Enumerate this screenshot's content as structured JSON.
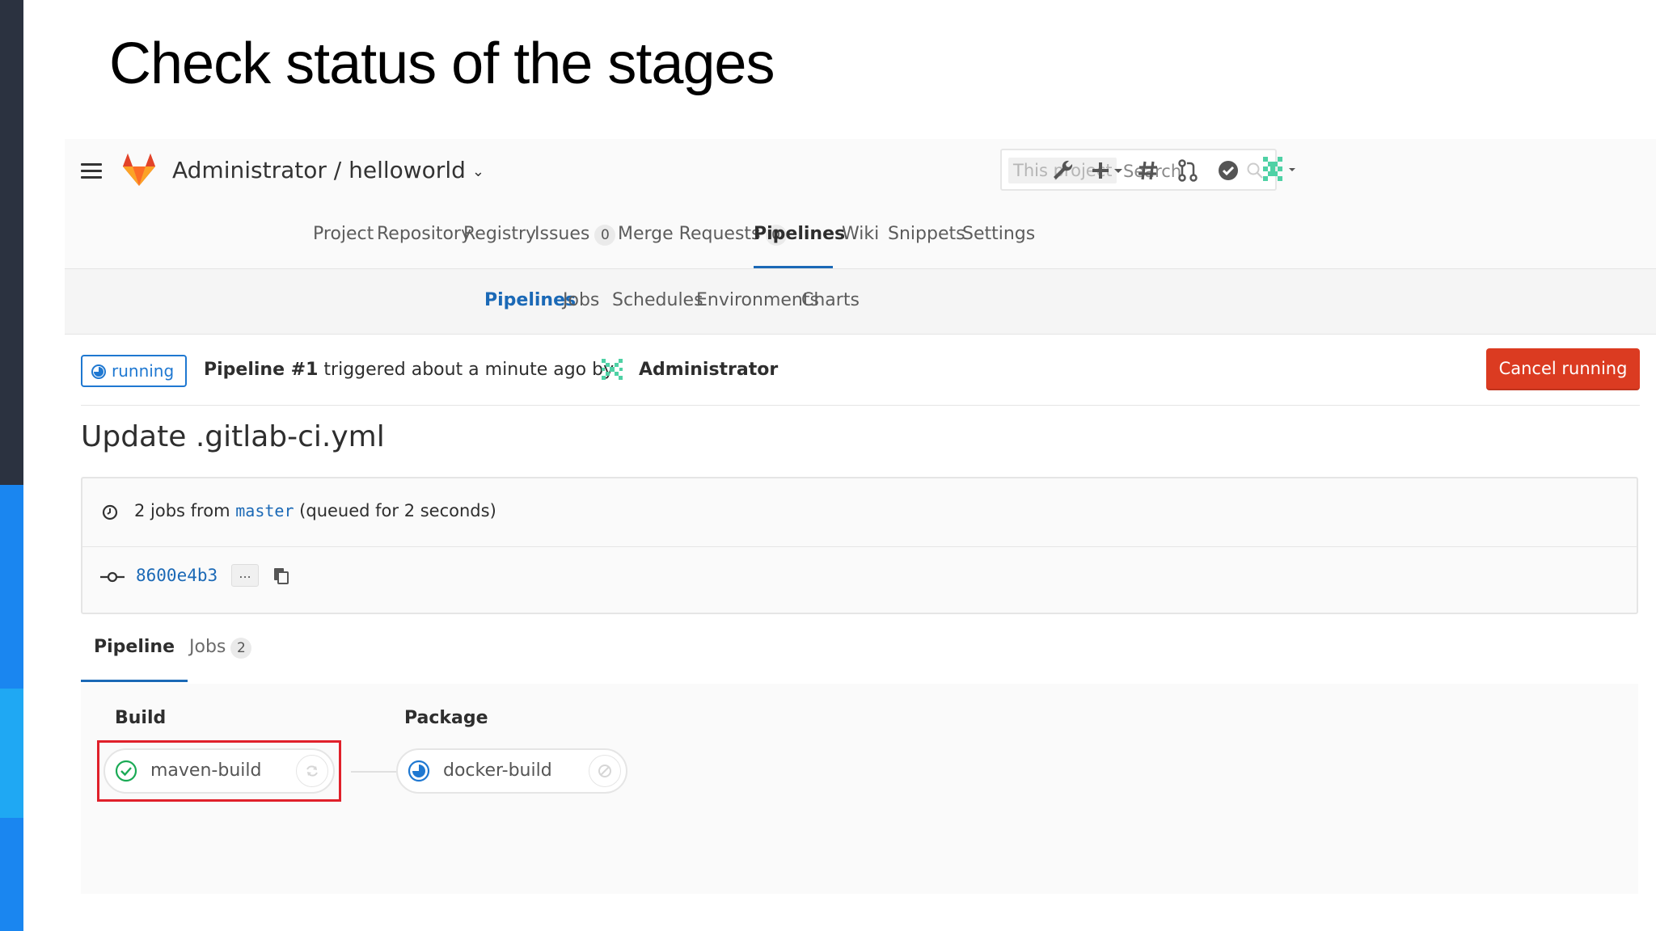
{
  "slide": {
    "title": "Check status of the stages"
  },
  "header": {
    "project_path": "Administrator / helloworld",
    "search": {
      "scope": "This project",
      "placeholder": "Search"
    },
    "icons": [
      "admin-wrench-icon",
      "plus-icon",
      "todos-hash-icon",
      "merge-request-icon",
      "issues-check-icon",
      "avatar-identicon"
    ]
  },
  "nav": {
    "items": [
      {
        "label": "Project"
      },
      {
        "label": "Repository"
      },
      {
        "label": "Registry"
      },
      {
        "label": "Issues",
        "count": "0"
      },
      {
        "label": "Merge Requests",
        "count": "0"
      },
      {
        "label": "Pipelines",
        "active": true
      },
      {
        "label": "Wiki"
      },
      {
        "label": "Snippets"
      },
      {
        "label": "Settings"
      }
    ]
  },
  "subnav": {
    "items": [
      {
        "label": "Pipelines",
        "active": true
      },
      {
        "label": "Jobs"
      },
      {
        "label": "Schedules"
      },
      {
        "label": "Environments"
      },
      {
        "label": "Charts"
      }
    ]
  },
  "pipeline": {
    "status": "running",
    "title_bold": "Pipeline #1",
    "title_rest": "triggered about a minute ago by",
    "user": "Administrator",
    "cancel_label": "Cancel running",
    "commit_title": "Update .gitlab-ci.yml",
    "jobs_prefix": "2 jobs from",
    "branch": "master",
    "jobs_suffix": "(queued for 2 seconds)",
    "sha": "8600e4b3",
    "ellipsis": "..."
  },
  "tabs": [
    {
      "label": "Pipeline",
      "active": true
    },
    {
      "label": "Jobs",
      "count": "2"
    }
  ],
  "stages": [
    {
      "name": "Build",
      "jobs": [
        {
          "name": "maven-build",
          "status": "success",
          "action": "retry"
        }
      ]
    },
    {
      "name": "Package",
      "jobs": [
        {
          "name": "docker-build",
          "status": "running",
          "action": "cancel"
        }
      ]
    }
  ],
  "colors": {
    "accent_blue": "#1b69b6",
    "running_blue": "#1f78d1",
    "success_green": "#1aaa55",
    "cancel_red": "#db3b21",
    "highlight_red": "#e0202a"
  }
}
